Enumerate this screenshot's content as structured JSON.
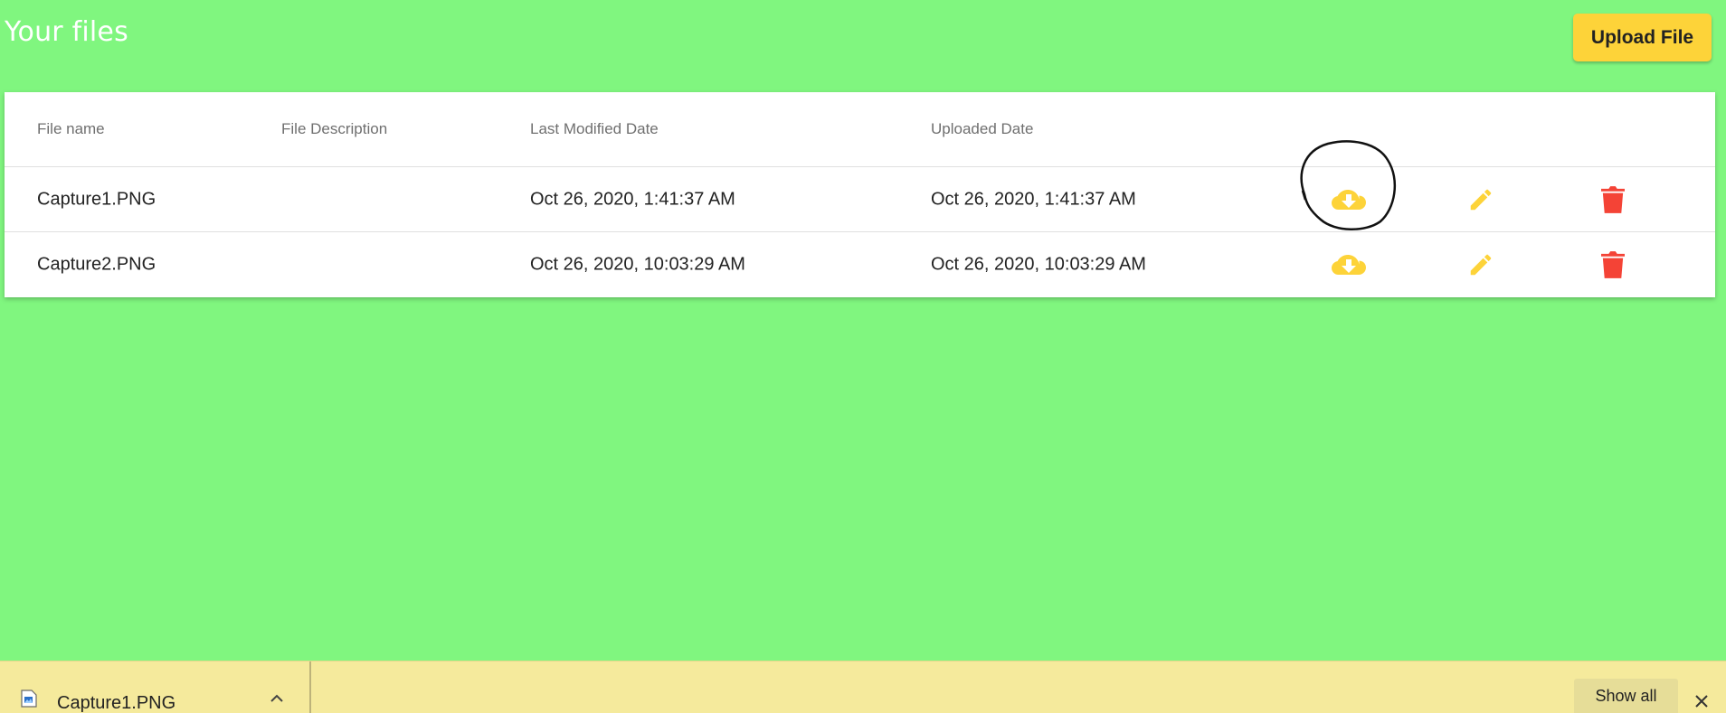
{
  "header": {
    "title": "Your files",
    "upload_label": "Upload File"
  },
  "table": {
    "columns": [
      "File name",
      "File Description",
      "Last Modified Date",
      "Uploaded Date"
    ],
    "rows": [
      {
        "file_name": "Capture1.PNG",
        "description": "",
        "last_modified": "Oct 26, 2020, 1:41:37 AM",
        "uploaded": "Oct 26, 2020, 1:41:37 AM"
      },
      {
        "file_name": "Capture2.PNG",
        "description": "",
        "last_modified": "Oct 26, 2020, 10:03:29 AM",
        "uploaded": "Oct 26, 2020, 10:03:29 AM"
      }
    ],
    "row_actions": [
      "cloud-download-icon",
      "pencil-icon",
      "trash-icon"
    ]
  },
  "download_bar": {
    "file_name": "Capture1.PNG",
    "show_all_label": "Show all"
  },
  "colors": {
    "background": "#80f67f",
    "accent": "#fdd339",
    "delete": "#f44336",
    "download_bar": "#f5ea9c"
  }
}
